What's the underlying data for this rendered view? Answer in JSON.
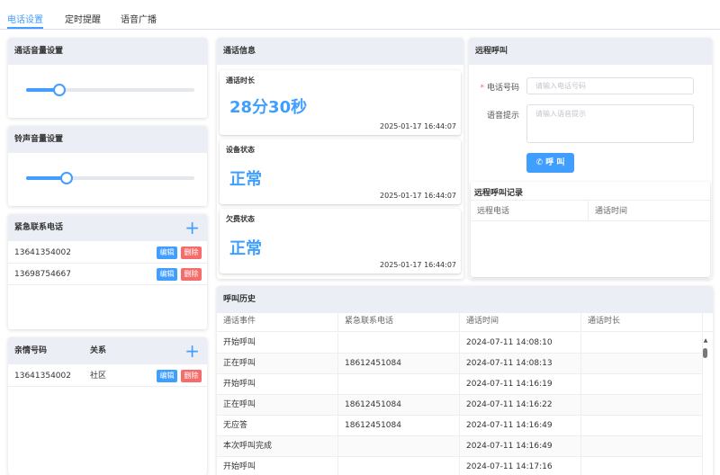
{
  "tabs": [
    {
      "label": "电话设置",
      "active": true
    },
    {
      "label": "定时提醒",
      "active": false
    },
    {
      "label": "语音广播",
      "active": false
    }
  ],
  "volume": {
    "title": "通话音量设置",
    "level": 0.2
  },
  "ringtone": {
    "title": "铃声音量设置",
    "level": 0.24
  },
  "emergency": {
    "title": "紧急联系电话",
    "edit_label": "编辑",
    "delete_label": "删除",
    "rows": [
      "13641354002",
      "13698754667"
    ]
  },
  "family": {
    "col1": "亲情号码",
    "col2": "关系",
    "edit_label": "编辑",
    "delete_label": "删除",
    "rows": [
      {
        "number": "13641354002",
        "relation": "社区"
      }
    ]
  },
  "call_info": {
    "title": "通话信息",
    "cards": [
      {
        "title": "通话时长",
        "value": "28分30秒",
        "time": "2025-01-17 16:44:07"
      },
      {
        "title": "设备状态",
        "value": "正常",
        "time": "2025-01-17 16:44:07"
      },
      {
        "title": "欠费状态",
        "value": "正常",
        "time": "2025-01-17 16:44:07"
      }
    ]
  },
  "remote_call": {
    "title": "远程呼叫",
    "phone_label": "电话号码",
    "phone_placeholder": "请输入电话号码",
    "voice_label": "语音提示",
    "voice_placeholder": "请输入语音提示",
    "call_button": "呼 叫",
    "records_title": "远程呼叫记录",
    "records_cols": [
      "远程电话",
      "通话时间"
    ]
  },
  "history": {
    "title": "呼叫历史",
    "cols": [
      "通话事件",
      "紧急联系电话",
      "通话时间",
      "通话时长"
    ],
    "rows": [
      [
        "开始呼叫",
        "",
        "2024-07-11 14:08:10",
        ""
      ],
      [
        "正在呼叫",
        "18612451084",
        "2024-07-11 14:08:13",
        ""
      ],
      [
        "开始呼叫",
        "",
        "2024-07-11 14:16:19",
        ""
      ],
      [
        "正在呼叫",
        "18612451084",
        "2024-07-11 14:16:22",
        ""
      ],
      [
        "无应答",
        "18612451084",
        "2024-07-11 14:16:49",
        ""
      ],
      [
        "本次呼叫完成",
        "",
        "2024-07-11 14:16:49",
        ""
      ],
      [
        "开始呼叫",
        "",
        "2024-07-11 14:17:16",
        ""
      ]
    ]
  },
  "colors": {
    "accent": "#409eff",
    "danger": "#f56c6c",
    "header_bg": "#ebeef5"
  }
}
